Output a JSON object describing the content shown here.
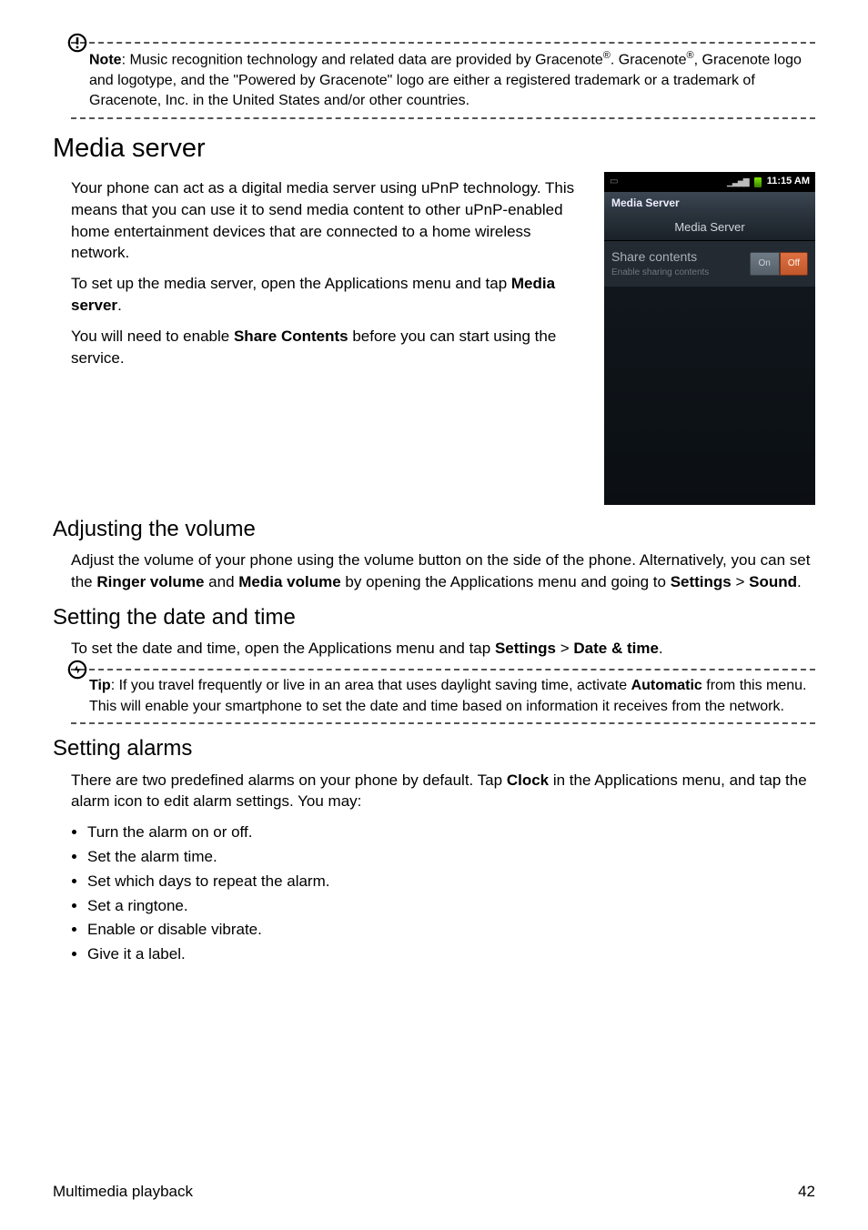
{
  "note_callout": {
    "label": "Note",
    "text_before_first_reg": ": Music recognition technology and related data are provided by Gracenote",
    "text_after_first_reg_1": ". Gracenote",
    "text_after_first_reg_2": ", Gracenote logo and logotype, and the \"Powered by Gracenote\" logo are either a registered trademark or a trademark of Gracenote, Inc. in the United States and/or other countries."
  },
  "media_server": {
    "heading": "Media server",
    "p1": "Your phone can act as a digital media server using uPnP technology. This means that you can use it to send media content to other uPnP-enabled home entertainment devices that are connected to a home wireless network.",
    "p2_a": "To set up the media server, open the Applications menu and tap ",
    "p2_b": "Media server",
    "p2_c": ".",
    "p3_a": "You will need to enable ",
    "p3_b": "Share Contents",
    "p3_c": " before you can start using the service."
  },
  "phone": {
    "time": "11:15 AM",
    "titlebar": "Media Server",
    "tab": "Media Server",
    "row_main": "Share contents",
    "row_sub": "Enable sharing contents",
    "on": "On",
    "off": "Off"
  },
  "adjust_volume": {
    "heading": "Adjusting the volume",
    "p_a": "Adjust the volume of your phone using the volume button on the side of the phone. Alternatively, you can set the ",
    "p_b": "Ringer volume",
    "p_c": " and ",
    "p_d": "Media volume",
    "p_e": " by opening the Applications menu and going to ",
    "p_f": "Settings",
    "p_g": " > ",
    "p_h": "Sound",
    "p_i": "."
  },
  "date_time": {
    "heading": "Setting the date and time",
    "p_a": "To set the date and time, open the Applications menu and tap ",
    "p_b": "Settings",
    "p_c": " > ",
    "p_d": "Date & time",
    "p_e": "."
  },
  "tip_callout": {
    "label": "Tip",
    "text_a": ": If you travel frequently or live in an area that uses daylight saving time, activate ",
    "text_b": "Automatic",
    "text_c": " from this menu. This will enable your smartphone to set the date and time based on information it receives from the network."
  },
  "alarms": {
    "heading": "Setting alarms",
    "p_a": "There are two predefined alarms on your phone by default. Tap ",
    "p_b": "Clock",
    "p_c": " in the Applications menu, and tap the alarm icon to edit alarm settings. You may:",
    "items": [
      "Turn the alarm on or off.",
      "Set the alarm time.",
      "Set which days to repeat the alarm.",
      "Set a ringtone.",
      "Enable or disable vibrate.",
      "Give it a label."
    ]
  },
  "footer": {
    "section": "Multimedia playback",
    "page": "42"
  }
}
